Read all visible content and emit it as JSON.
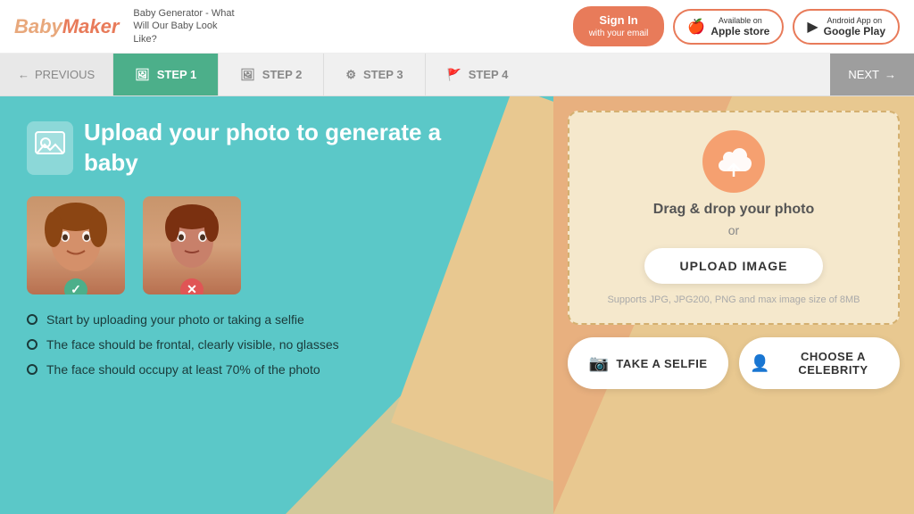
{
  "header": {
    "logo": "BabyMaker",
    "tagline": "Baby Generator - What Will Our Baby Look Like?",
    "signin_label": "Sign In",
    "signin_sub": "with your email",
    "apple_store_label": "Available on",
    "apple_store_sub": "Apple store",
    "android_store_label": "Android App on",
    "android_store_sub": "Google Play"
  },
  "steps_bar": {
    "previous": "PREVIOUS",
    "next": "NEXT",
    "steps": [
      {
        "label": "STEP 1",
        "active": true
      },
      {
        "label": "STEP 2",
        "active": false
      },
      {
        "label": "STEP 3",
        "active": false
      },
      {
        "label": "STEP 4",
        "active": false
      }
    ]
  },
  "left_panel": {
    "heading": "Upload your photo to generate a baby",
    "good_photo_alt": "Good example photo",
    "bad_photo_alt": "Bad example photo",
    "instructions": [
      "Start by uploading your photo or taking a selfie",
      "The face should be frontal, clearly visible, no glasses",
      "The face should occupy at least 70% of the photo"
    ]
  },
  "right_panel": {
    "drag_text": "Drag & drop your photo",
    "or_text": "or",
    "upload_button": "UPLOAD IMAGE",
    "supports_text": "Supports JPG, JPG200, PNG and max image size of 8MB",
    "selfie_button": "TAKE A SELFIE",
    "celebrity_button": "CHOOSE A CELEBRITY"
  },
  "colors": {
    "teal": "#5bc8c8",
    "green": "#4caf8a",
    "red": "#e05555",
    "orange": "#e87b5a",
    "sand": "#e8c890",
    "light_sand": "#f5e8cc"
  }
}
